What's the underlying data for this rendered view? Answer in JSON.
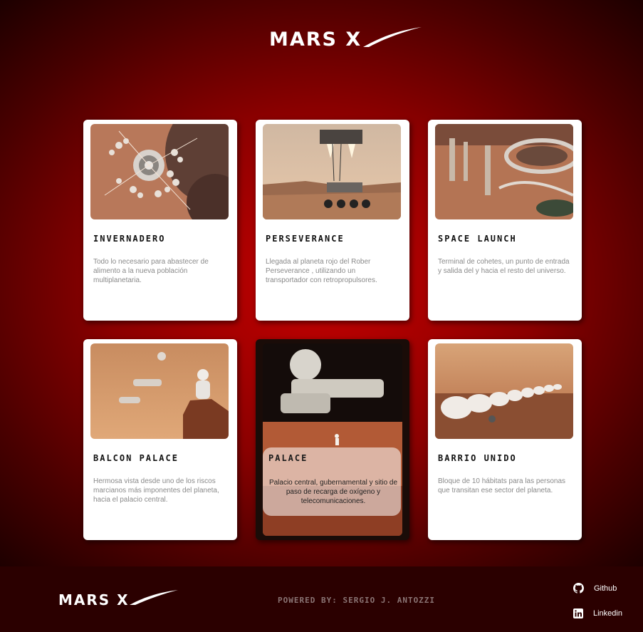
{
  "brand": {
    "name": "MARS X"
  },
  "cards": [
    {
      "title": "Invernadero",
      "description": "Todo lo necesario para abastecer de alimento a la nueva población multiplanetaria."
    },
    {
      "title": "Perseverance",
      "description": "Llegada al planeta rojo del Rober Perseverance , utilizando un transportador con retropropulsores."
    },
    {
      "title": "Space Launch",
      "description": "Terminal de cohetes, un punto de entrada y salida del y hacia el resto del universo."
    },
    {
      "title": "Balcon Palace",
      "description": "Hermosa vista desde uno de los riscos marcianos más imponentes del planeta, hacia el palacio central."
    },
    {
      "title": "Palace",
      "description": "Palacio central, gubernamental y sitio de paso de recarga de oxígeno y telecomunicaciones."
    },
    {
      "title": "Barrio Unido",
      "description": "Bloque de 10 hábitats para las personas que transitan ese sector del planeta."
    }
  ],
  "footer": {
    "powered_by": "Powered by: Sergio J. Antozzi",
    "links": [
      {
        "label": "Github",
        "icon": "github-icon"
      },
      {
        "label": "Linkedin",
        "icon": "linkedin-icon"
      }
    ]
  },
  "colors": {
    "accent": "#c40000",
    "footer_bg": "#2b0000"
  }
}
